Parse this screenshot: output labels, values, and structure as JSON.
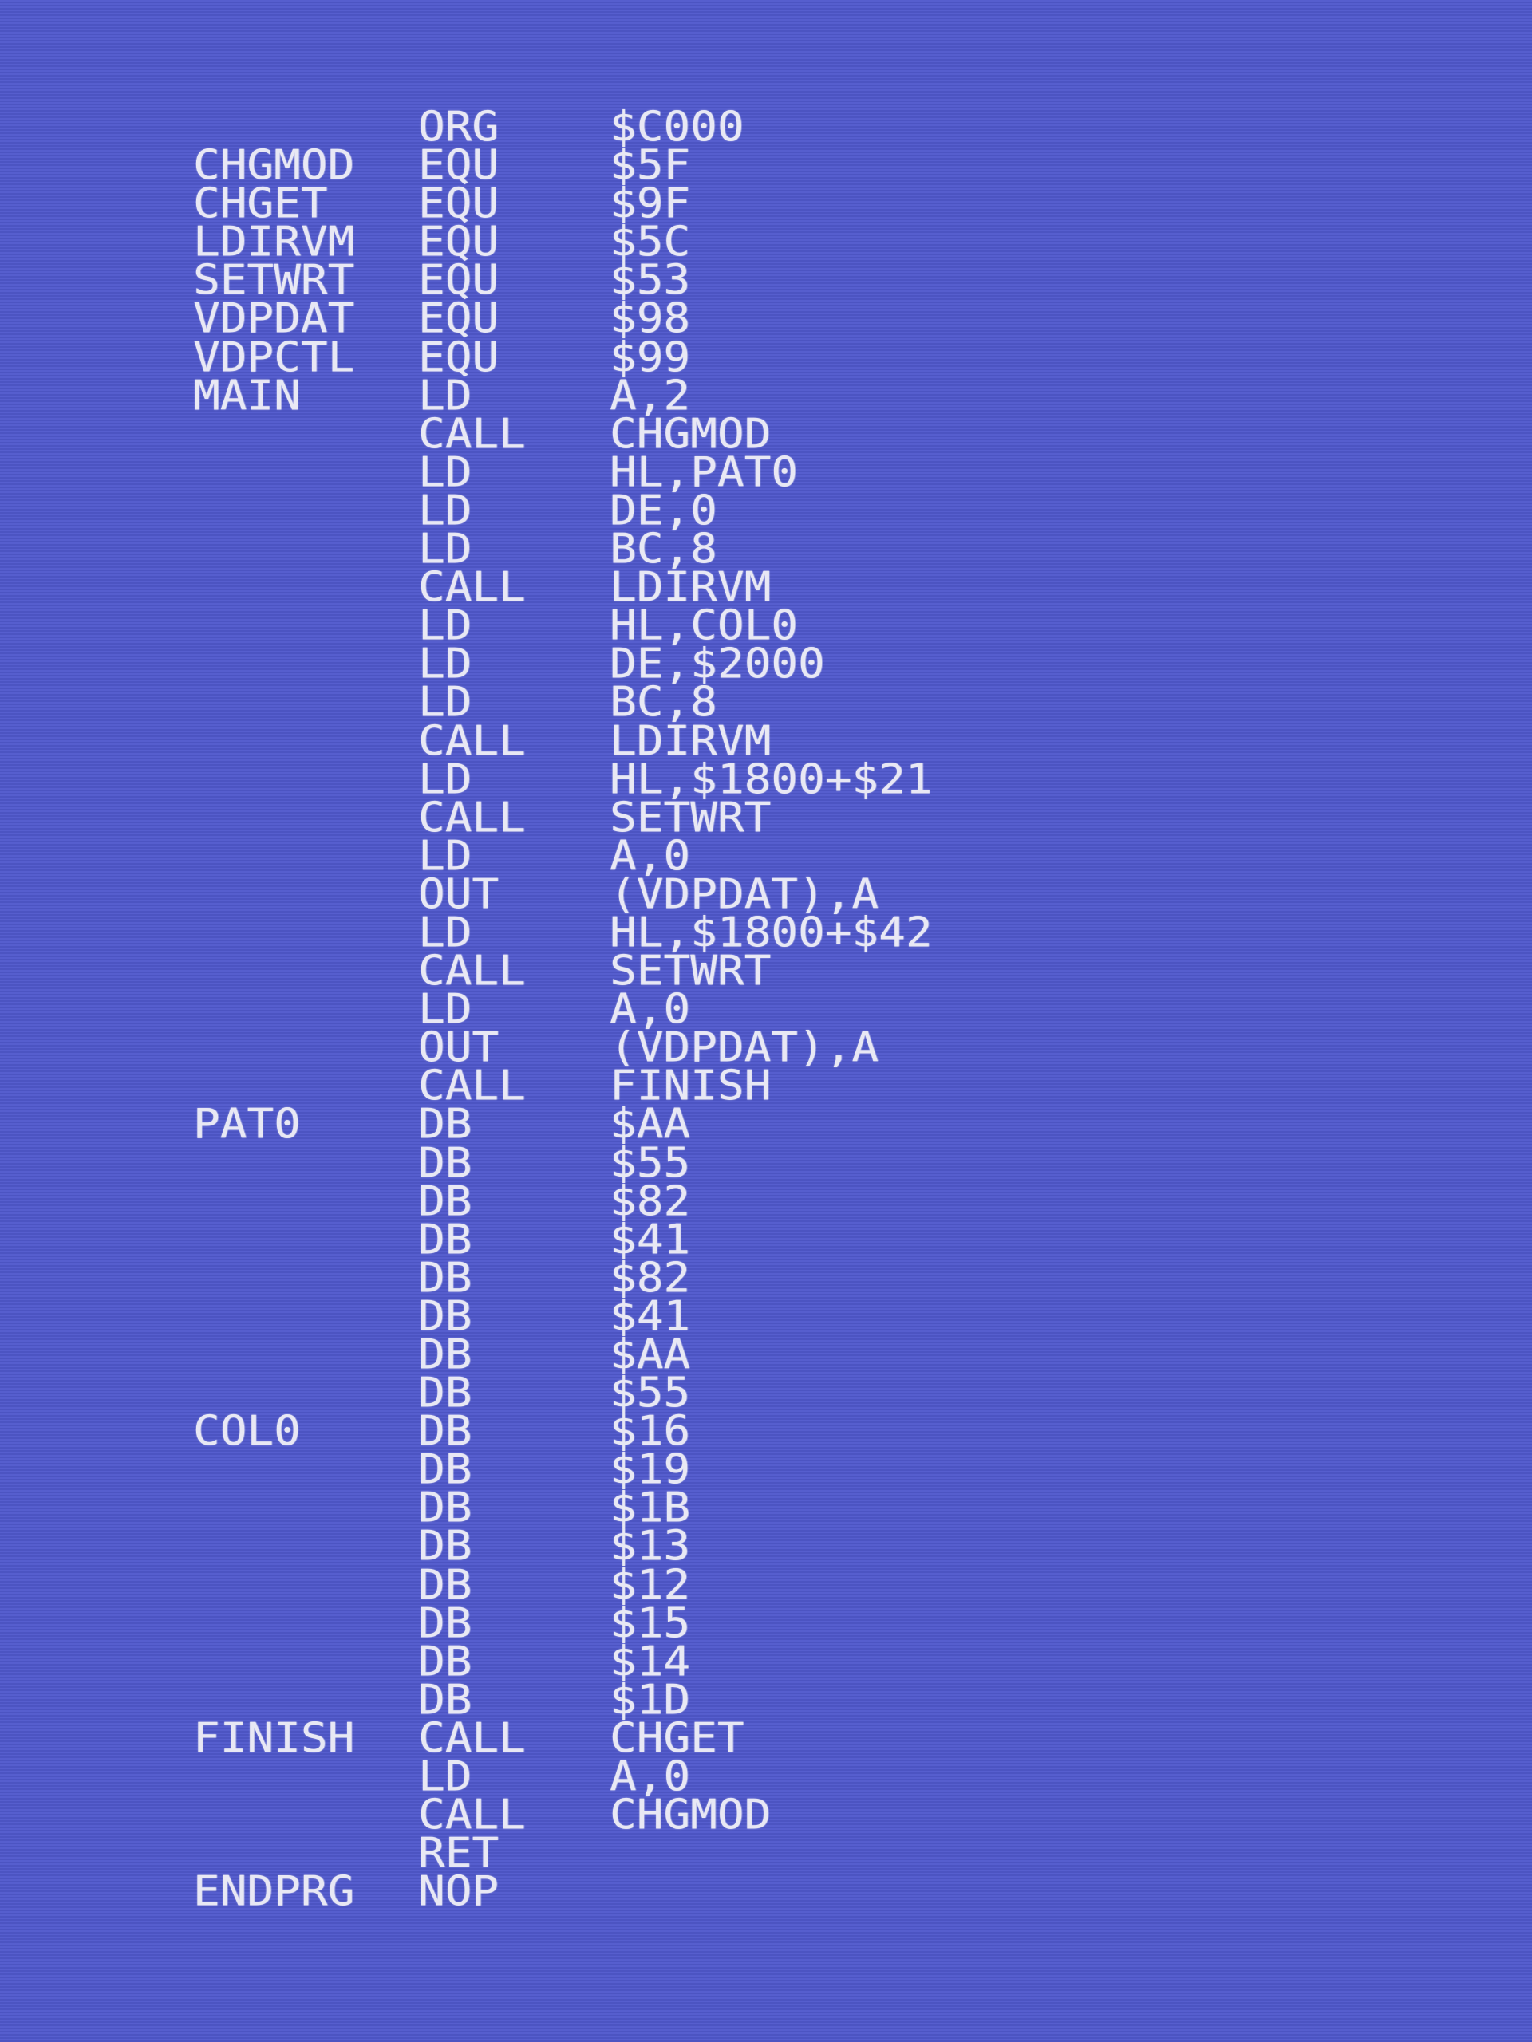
{
  "screen": {
    "background_color": "#5058cc",
    "text_color": "#e8e8f4"
  },
  "program": {
    "lines": [
      {
        "label": "",
        "op": "ORG",
        "arg": "$C000"
      },
      {
        "label": "CHGMOD",
        "op": "EQU",
        "arg": "$5F"
      },
      {
        "label": "CHGET",
        "op": "EQU",
        "arg": "$9F"
      },
      {
        "label": "LDIRVM",
        "op": "EQU",
        "arg": "$5C"
      },
      {
        "label": "SETWRT",
        "op": "EQU",
        "arg": "$53"
      },
      {
        "label": "VDPDAT",
        "op": "EQU",
        "arg": "$98"
      },
      {
        "label": "VDPCTL",
        "op": "EQU",
        "arg": "$99"
      },
      {
        "label": "MAIN",
        "op": "LD",
        "arg": "A,2"
      },
      {
        "label": "",
        "op": "CALL",
        "arg": "CHGMOD"
      },
      {
        "label": "",
        "op": "LD",
        "arg": "HL,PAT0"
      },
      {
        "label": "",
        "op": "LD",
        "arg": "DE,0"
      },
      {
        "label": "",
        "op": "LD",
        "arg": "BC,8"
      },
      {
        "label": "",
        "op": "CALL",
        "arg": "LDIRVM"
      },
      {
        "label": "",
        "op": "LD",
        "arg": "HL,COL0"
      },
      {
        "label": "",
        "op": "LD",
        "arg": "DE,$2000"
      },
      {
        "label": "",
        "op": "LD",
        "arg": "BC,8"
      },
      {
        "label": "",
        "op": "CALL",
        "arg": "LDIRVM"
      },
      {
        "label": "",
        "op": "LD",
        "arg": "HL,$1800+$21"
      },
      {
        "label": "",
        "op": "CALL",
        "arg": "SETWRT"
      },
      {
        "label": "",
        "op": "LD",
        "arg": "A,0"
      },
      {
        "label": "",
        "op": "OUT",
        "arg": "(VDPDAT),A"
      },
      {
        "label": "",
        "op": "LD",
        "arg": "HL,$1800+$42"
      },
      {
        "label": "",
        "op": "CALL",
        "arg": "SETWRT"
      },
      {
        "label": "",
        "op": "LD",
        "arg": "A,0"
      },
      {
        "label": "",
        "op": "OUT",
        "arg": "(VDPDAT),A"
      },
      {
        "label": "",
        "op": "CALL",
        "arg": "FINISH"
      },
      {
        "label": "PAT0",
        "op": "DB",
        "arg": "$AA"
      },
      {
        "label": "",
        "op": "DB",
        "arg": "$55"
      },
      {
        "label": "",
        "op": "DB",
        "arg": "$82"
      },
      {
        "label": "",
        "op": "DB",
        "arg": "$41"
      },
      {
        "label": "",
        "op": "DB",
        "arg": "$82"
      },
      {
        "label": "",
        "op": "DB",
        "arg": "$41"
      },
      {
        "label": "",
        "op": "DB",
        "arg": "$AA"
      },
      {
        "label": "",
        "op": "DB",
        "arg": "$55"
      },
      {
        "label": "COL0",
        "op": "DB",
        "arg": "$16"
      },
      {
        "label": "",
        "op": "DB",
        "arg": "$19"
      },
      {
        "label": "",
        "op": "DB",
        "arg": "$1B"
      },
      {
        "label": "",
        "op": "DB",
        "arg": "$13"
      },
      {
        "label": "",
        "op": "DB",
        "arg": "$12"
      },
      {
        "label": "",
        "op": "DB",
        "arg": "$15"
      },
      {
        "label": "",
        "op": "DB",
        "arg": "$14"
      },
      {
        "label": "",
        "op": "DB",
        "arg": "$1D"
      },
      {
        "label": "FINISH",
        "op": "CALL",
        "arg": "CHGET"
      },
      {
        "label": "",
        "op": "LD",
        "arg": "A,0"
      },
      {
        "label": "",
        "op": "CALL",
        "arg": "CHGMOD"
      },
      {
        "label": "",
        "op": "RET",
        "arg": ""
      },
      {
        "label": "ENDPRG",
        "op": "NOP",
        "arg": ""
      }
    ]
  }
}
